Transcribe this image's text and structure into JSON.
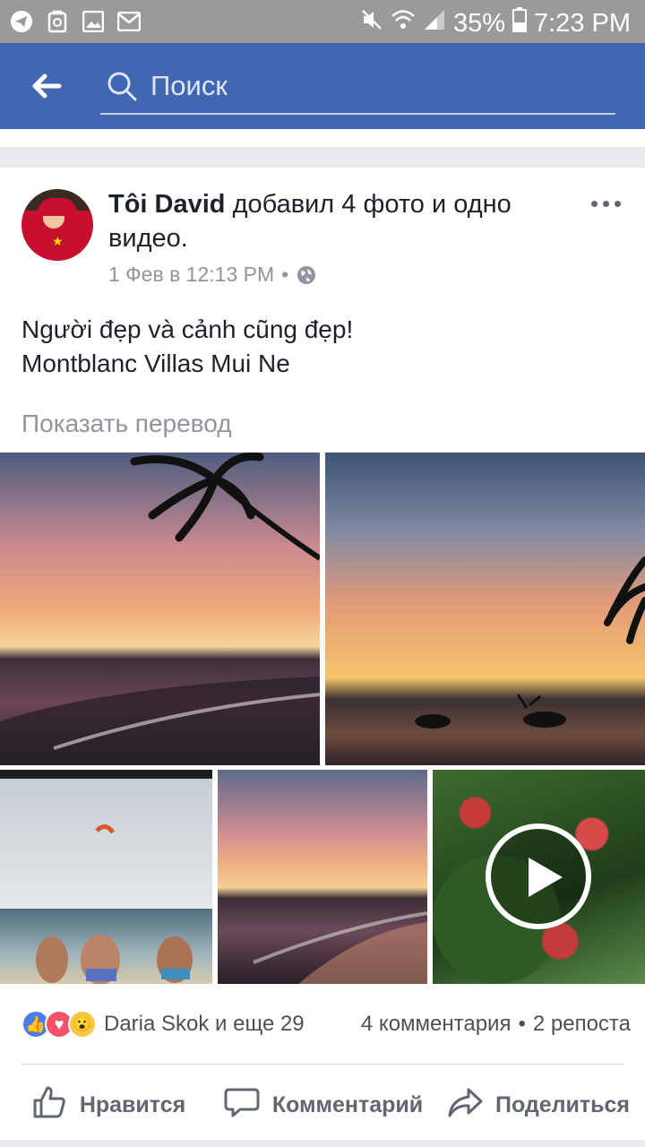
{
  "status_bar": {
    "battery": "35%",
    "time": "7:23 PM"
  },
  "appbar": {
    "search_placeholder": "Поиск"
  },
  "post": {
    "author": "Tôi David",
    "action": "добавил 4 фото и одно видео.",
    "date": "1 Фев в 12:13 PM",
    "separator": "•",
    "text_line1": "Người đẹp và cảnh cũng đẹp!",
    "text_line2": "Montblanc Villas Mui Ne",
    "translate_link": "Показать перевод",
    "reactions_names": "Daria Skok и еще 29",
    "comments_count": "4 комментария",
    "stats_separator": "•",
    "shares_count": "2 репоста"
  },
  "actions": {
    "like": "Нравится",
    "comment": "Комментарий",
    "share": "Поделиться"
  },
  "colors": {
    "brand": "#4267b2",
    "status_bar": "#9a9a9a"
  },
  "icons": [
    "telegram-icon",
    "recycle-icon",
    "image-icon",
    "mail-icon",
    "mute-icon",
    "wifi-icon",
    "signal-icon",
    "battery-icon",
    "back-arrow-icon",
    "search-icon",
    "more-icon",
    "globe-icon",
    "like-icon",
    "comment-icon",
    "share-icon",
    "play-icon"
  ]
}
